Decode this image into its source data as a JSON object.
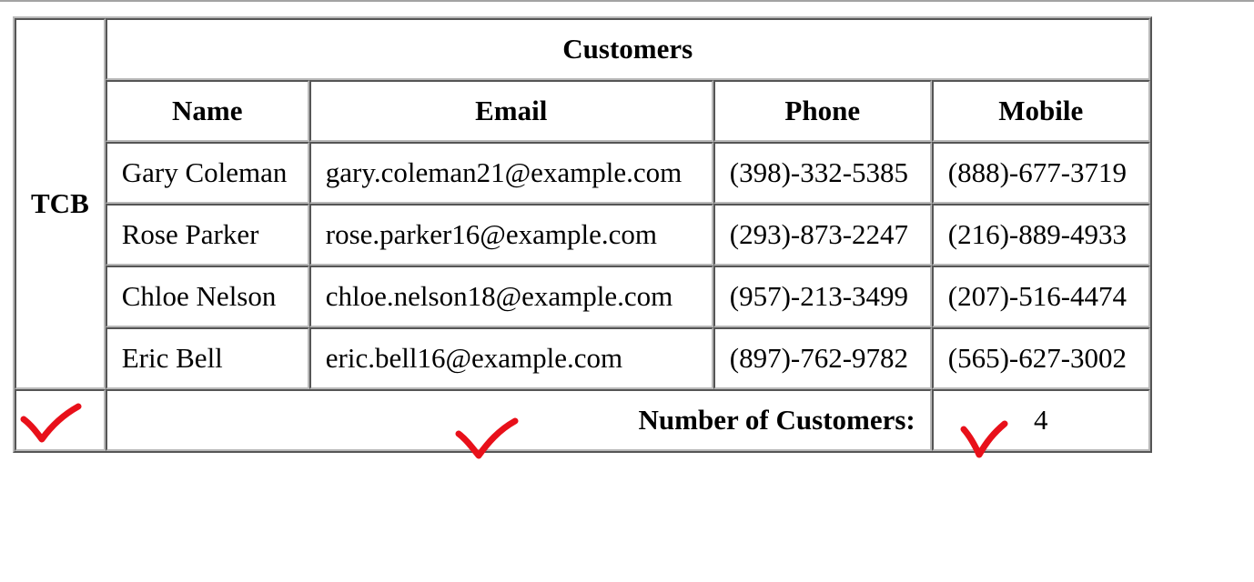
{
  "table": {
    "caption": "Customers",
    "group_label": "TCB",
    "headers": [
      "Name",
      "Email",
      "Phone",
      "Mobile"
    ],
    "rows": [
      {
        "name": "Gary Coleman",
        "email": "gary.coleman21@example.com",
        "phone": "(398)-332-5385",
        "mobile": "(888)-677-3719"
      },
      {
        "name": "Rose Parker",
        "email": "rose.parker16@example.com",
        "phone": "(293)-873-2247",
        "mobile": "(216)-889-4933"
      },
      {
        "name": "Chloe Nelson",
        "email": "chloe.nelson18@example.com",
        "phone": "(957)-213-3499",
        "mobile": "(207)-516-4474"
      },
      {
        "name": "Eric Bell",
        "email": "eric.bell16@example.com",
        "phone": "(897)-762-9782",
        "mobile": "(565)-627-3002"
      }
    ],
    "footer_label": "Number of Customers:",
    "footer_count": "4"
  },
  "marks": {
    "check_color": "#e8101a",
    "icon": "red-checkmark-icon"
  }
}
